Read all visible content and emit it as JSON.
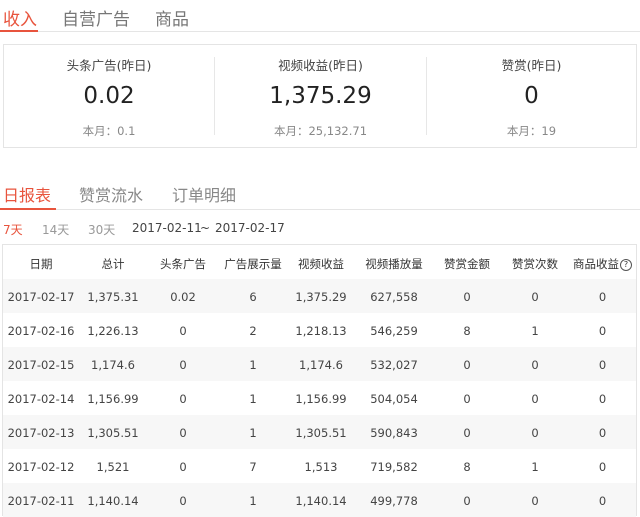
{
  "top_tabs": [
    "收入",
    "自营广告",
    "商品"
  ],
  "summary": [
    {
      "label": "头条广告(昨日)",
      "value": "0.02",
      "sub": "本月：0.1"
    },
    {
      "label": "视频收益(昨日)",
      "value": "1,375.29",
      "sub": "本月：25,132.71"
    },
    {
      "label": "赞赏(昨日)",
      "value": "0",
      "sub": "本月：19"
    }
  ],
  "sub_tabs": [
    "日报表",
    "赞赏流水",
    "订单明细"
  ],
  "ranges": [
    "7天",
    "14天",
    "30天"
  ],
  "date_range": {
    "start": "2017-02-11",
    "sep": "~",
    "end": "2017-02-17"
  },
  "table": {
    "headers": [
      "日期",
      "总计",
      "头条广告",
      "广告展示量",
      "视频收益",
      "视频播放量",
      "赞赏金额",
      "赞赏次数",
      "商品收益"
    ],
    "help_icon": "question-circle-icon",
    "rows": [
      [
        "2017-02-17",
        "1,375.31",
        "0.02",
        "6",
        "1,375.29",
        "627,558",
        "0",
        "0",
        "0"
      ],
      [
        "2017-02-16",
        "1,226.13",
        "0",
        "2",
        "1,218.13",
        "546,259",
        "8",
        "1",
        "0"
      ],
      [
        "2017-02-15",
        "1,174.6",
        "0",
        "1",
        "1,174.6",
        "532,027",
        "0",
        "0",
        "0"
      ],
      [
        "2017-02-14",
        "1,156.99",
        "0",
        "1",
        "1,156.99",
        "504,054",
        "0",
        "0",
        "0"
      ],
      [
        "2017-02-13",
        "1,305.51",
        "0",
        "1",
        "1,305.51",
        "590,843",
        "0",
        "0",
        "0"
      ],
      [
        "2017-02-12",
        "1,521",
        "0",
        "7",
        "1,513",
        "719,582",
        "8",
        "1",
        "0"
      ],
      [
        "2017-02-11",
        "1,140.14",
        "0",
        "1",
        "1,140.14",
        "499,778",
        "0",
        "0",
        "0"
      ]
    ]
  }
}
